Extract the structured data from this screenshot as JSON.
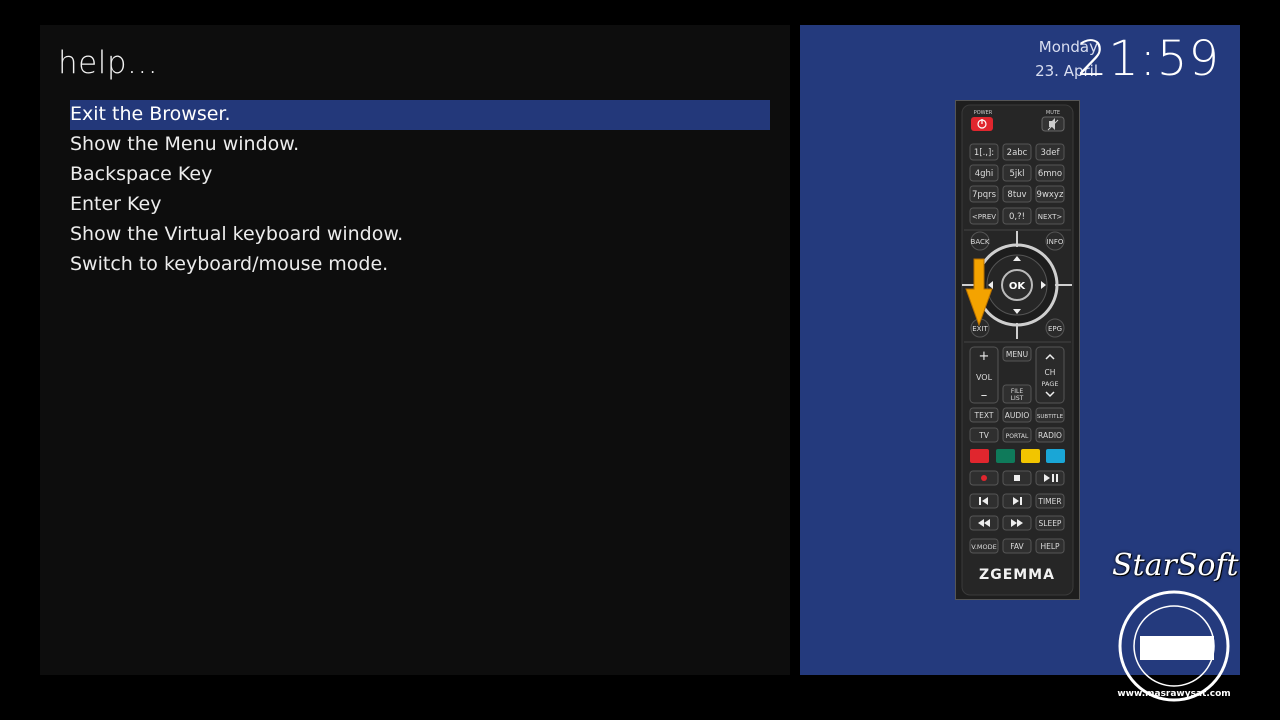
{
  "left": {
    "title": "help...",
    "items": [
      {
        "label": "Exit the Browser.",
        "selected": true
      },
      {
        "label": "Show the Menu window.",
        "selected": false
      },
      {
        "label": "Backspace Key",
        "selected": false
      },
      {
        "label": "Enter Key",
        "selected": false
      },
      {
        "label": "Show the Virtual keyboard window.",
        "selected": false
      },
      {
        "label": "Switch to keyboard/mouse mode.",
        "selected": false
      }
    ]
  },
  "right": {
    "day": "Monday",
    "date": "23. April",
    "time": "21:59"
  },
  "remote": {
    "power": "POWER",
    "mute": "MUTE",
    "numbers": [
      "1[.,]:",
      "2abc",
      "3def",
      "4ghi",
      "5jkl",
      "6mno",
      "7pqrs",
      "8tuv",
      "9wxyz"
    ],
    "prev": "<PREV",
    "zero": "0,?!",
    "next": "NEXT>",
    "back": "BACK",
    "info": "INFO",
    "ok": "OK",
    "exit": "EXIT",
    "epg": "EPG",
    "vol": "VOL",
    "menu": "MENU",
    "ch": "CH",
    "page": "PAGE",
    "file": "FILE",
    "list": "LIST",
    "text": "TEXT",
    "audio": "AUDIO",
    "subtitle": "SUBTITLE",
    "tv": "TV",
    "portal": "PORTAL",
    "radio": "RADIO",
    "timer": "TIMER",
    "sleep": "SLEEP",
    "vmode": "V.MODE",
    "fav": "FAV",
    "help": "HELP",
    "brand": "ZGEMMA",
    "color_keys": [
      "#e0262e",
      "#0f7a5a",
      "#f2c500",
      "#1aa6d6"
    ],
    "highlight_color": "#f4a300"
  },
  "watermark": {
    "brand": "StarSoft",
    "site": "www.masrawysat.com"
  }
}
